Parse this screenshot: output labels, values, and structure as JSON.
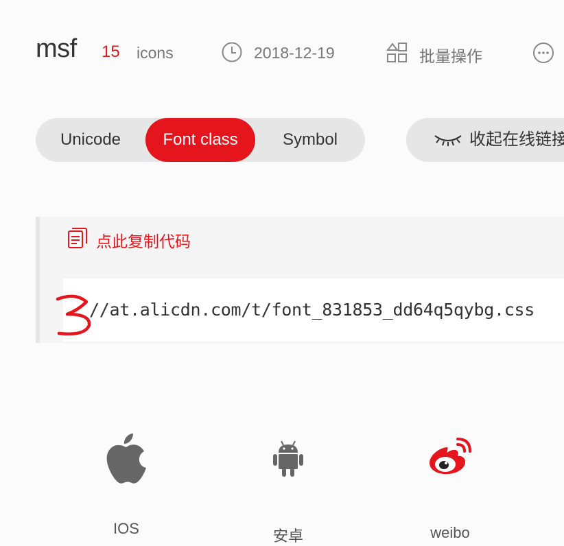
{
  "header": {
    "project_name": "msf",
    "icon_count": "15",
    "icon_unit": "icons",
    "date": "2018-12-19",
    "batch_label": "批量操作"
  },
  "tabs": [
    {
      "label": "Unicode",
      "active": false
    },
    {
      "label": "Font class",
      "active": true
    },
    {
      "label": "Symbol",
      "active": false
    }
  ],
  "collapse_label": "收起在线链接",
  "code": {
    "copy_label": "点此复制代码",
    "url": "//at.alicdn.com/t/font_831853_dd64q5qybg.css",
    "annotation": "3"
  },
  "icons": [
    {
      "name": "IOS",
      "icon": "apple-icon"
    },
    {
      "name": "安卓",
      "icon": "android-icon"
    },
    {
      "name": "weibo",
      "icon": "weibo-icon"
    }
  ],
  "colors": {
    "accent": "#e4151c",
    "tab_bg": "#e6e6e6",
    "icon_gray": "#666666"
  }
}
